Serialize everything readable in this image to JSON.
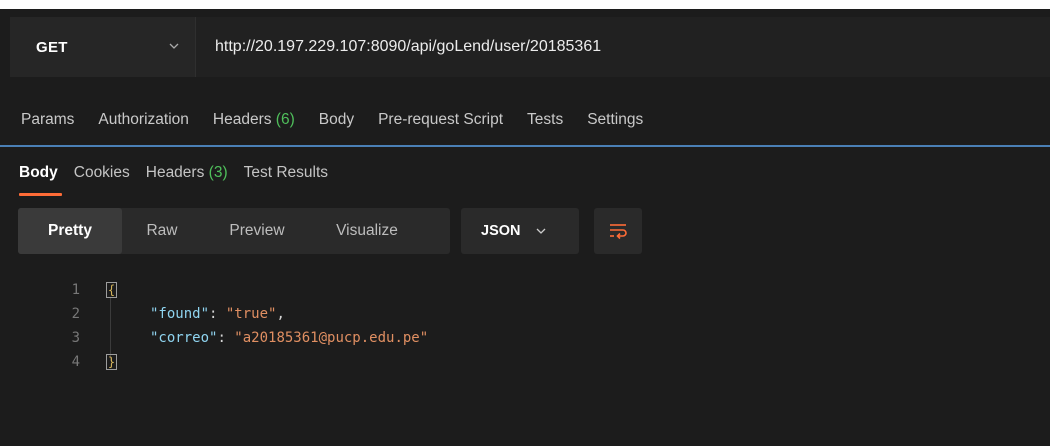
{
  "request": {
    "method": "GET",
    "url": "http://20.197.229.107:8090/api/goLend/user/20185361"
  },
  "request_tabs": [
    {
      "label": "Params"
    },
    {
      "label": "Authorization"
    },
    {
      "label": "Headers",
      "count": "(6)"
    },
    {
      "label": "Body"
    },
    {
      "label": "Pre-request Script"
    },
    {
      "label": "Tests"
    },
    {
      "label": "Settings"
    }
  ],
  "response_tabs": [
    {
      "label": "Body",
      "active": true
    },
    {
      "label": "Cookies"
    },
    {
      "label": "Headers",
      "count": "(3)"
    },
    {
      "label": "Test Results"
    }
  ],
  "view_modes": [
    "Pretty",
    "Raw",
    "Preview",
    "Visualize"
  ],
  "active_view": "Pretty",
  "format": "JSON",
  "code": {
    "line_numbers": [
      "1",
      "2",
      "3",
      "4"
    ],
    "open_brace": "{",
    "close_brace": "}",
    "entries": [
      {
        "key": "\"found\"",
        "value": "\"true\"",
        "trail": ","
      },
      {
        "key": "\"correo\"",
        "value": "\"a20185361@pucp.edu.pe\"",
        "trail": ""
      }
    ]
  },
  "colors": {
    "accent_orange": "#ff6c37",
    "divider_blue": "#4a7fb5",
    "count_green": "#4fbf5b",
    "json_key": "#8fd4f0",
    "json_string": "#e08f62"
  },
  "icons": {
    "method_dropdown": "chevron-down-icon",
    "format_dropdown": "chevron-down-icon",
    "wrap": "wrap-lines-icon"
  }
}
